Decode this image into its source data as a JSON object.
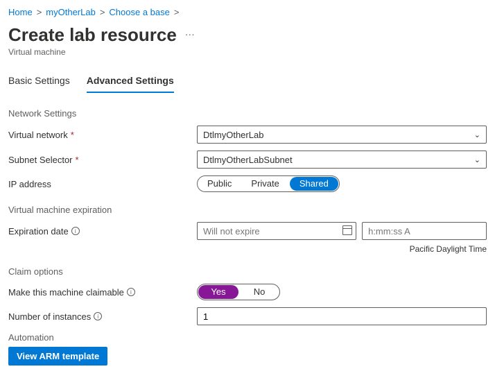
{
  "breadcrumbs": {
    "items": [
      "Home",
      "myOtherLab",
      "Choose a base"
    ]
  },
  "header": {
    "title": "Create lab resource",
    "subtitle": "Virtual machine"
  },
  "tabs": {
    "basic": "Basic Settings",
    "advanced": "Advanced Settings"
  },
  "sections": {
    "network": "Network Settings",
    "expiration": "Virtual machine expiration",
    "claim": "Claim options",
    "automation": "Automation"
  },
  "fields": {
    "vnet_label": "Virtual network",
    "vnet_value": "DtlmyOtherLab",
    "subnet_label": "Subnet Selector",
    "subnet_value": "DtlmyOtherLabSubnet",
    "ip_label": "IP address",
    "ip_options": {
      "public": "Public",
      "private": "Private",
      "shared": "Shared"
    },
    "exp_date_label": "Expiration date",
    "exp_date_placeholder": "Will not expire",
    "exp_time_placeholder": "h:mm:ss A",
    "tz": "Pacific Daylight Time",
    "claim_label": "Make this machine claimable",
    "claim_yes": "Yes",
    "claim_no": "No",
    "instances_label": "Number of instances",
    "instances_value": "1",
    "arm_button": "View ARM template"
  }
}
